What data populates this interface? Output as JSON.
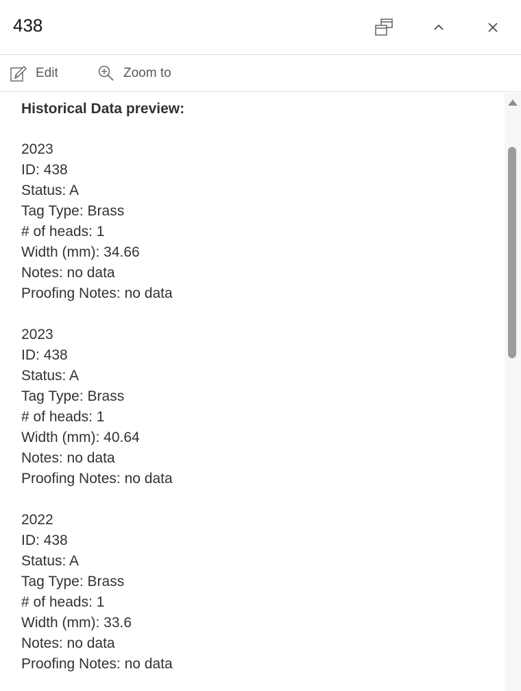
{
  "header": {
    "title": "438",
    "dock_icon": "dock-icon",
    "collapse_icon": "chevron-up-icon",
    "close_icon": "close-icon"
  },
  "toolbar": {
    "edit_label": "Edit",
    "edit_icon": "pencil-edit-icon",
    "zoom_label": "Zoom to",
    "zoom_icon": "zoom-in-icon"
  },
  "content": {
    "heading": "Historical Data preview:",
    "records": [
      {
        "year": "2023",
        "id": "ID: 438",
        "status": "Status: A",
        "tag_type": "Tag Type: Brass",
        "heads": "# of heads: 1",
        "width": "Width (mm): 34.66",
        "notes": "Notes: no data",
        "proofing_notes": "Proofing Notes: no data"
      },
      {
        "year": "2023",
        "id": "ID: 438",
        "status": "Status: A",
        "tag_type": "Tag Type: Brass",
        "heads": "# of heads: 1",
        "width": "Width (mm): 40.64",
        "notes": "Notes: no data",
        "proofing_notes": "Proofing Notes: no data"
      },
      {
        "year": "2022",
        "id": "ID: 438",
        "status": "Status: A",
        "tag_type": "Tag Type: Brass",
        "heads": "# of heads: 1",
        "width": "Width (mm): 33.6",
        "notes": "Notes: no data",
        "proofing_notes": "Proofing Notes: no data"
      }
    ]
  },
  "colors": {
    "text": "#323232",
    "icon": "#6a6a6a",
    "divider": "#e0e0e0",
    "scrollbar_thumb": "#9c9c9c"
  }
}
